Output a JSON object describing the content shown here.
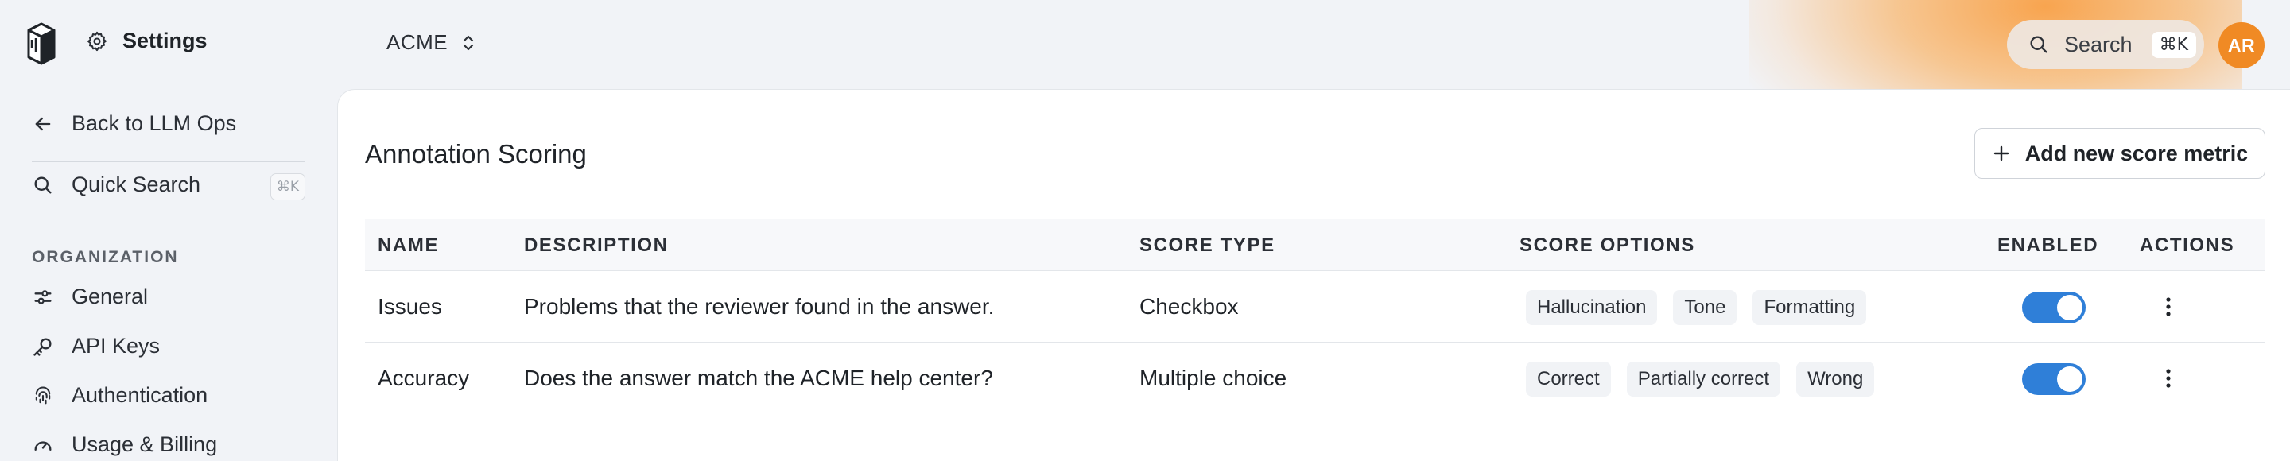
{
  "header": {
    "settings_title": "Settings",
    "org_name": "ACME",
    "search_label": "Search",
    "search_shortcut": "⌘K",
    "avatar_initials": "AR",
    "accent_color": "#f08a24"
  },
  "sidebar": {
    "back_label": "Back to LLM Ops",
    "quick_search_label": "Quick Search",
    "quick_search_shortcut": "⌘K",
    "section_label": "ORGANIZATION",
    "items": [
      {
        "label": "General",
        "icon": "sliders-icon"
      },
      {
        "label": "API Keys",
        "icon": "key-icon"
      },
      {
        "label": "Authentication",
        "icon": "fingerprint-icon"
      },
      {
        "label": "Usage & Billing",
        "icon": "gauge-icon"
      }
    ]
  },
  "main": {
    "title": "Annotation Scoring",
    "add_button_label": "Add new score metric",
    "columns": [
      "NAME",
      "DESCRIPTION",
      "SCORE TYPE",
      "SCORE OPTIONS",
      "ENABLED",
      "ACTIONS"
    ],
    "rows": [
      {
        "name": "Issues",
        "description": "Problems that the reviewer found in the answer.",
        "score_type": "Checkbox",
        "options": [
          "Hallucination",
          "Tone",
          "Formatting"
        ],
        "enabled": true
      },
      {
        "name": "Accuracy",
        "description": "Does the answer match the ACME help center?",
        "score_type": "Multiple choice",
        "options": [
          "Correct",
          "Partially correct",
          "Wrong"
        ],
        "enabled": true
      }
    ],
    "toggle_color": "#2f7fd8"
  }
}
